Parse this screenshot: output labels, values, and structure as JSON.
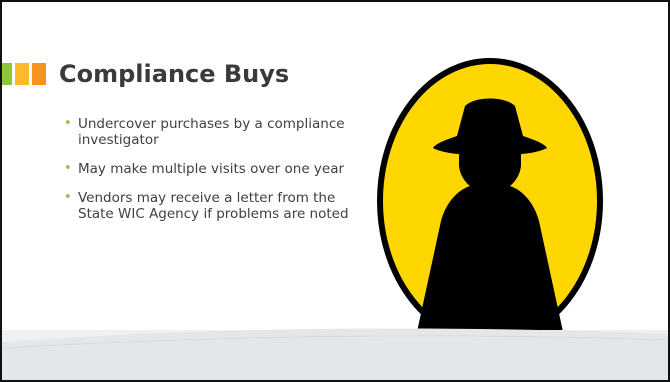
{
  "colors": {
    "accent_green": "#8cc63f",
    "accent_yellow": "#fdb927",
    "accent_orange": "#f7941d",
    "title_text": "#3a3a3a",
    "body_text": "#404040",
    "bullet": "#8cc63f",
    "figure_fill": "#ffd700",
    "figure_outline": "#000000"
  },
  "slide": {
    "title": "Compliance Buys",
    "bullets": [
      {
        "text": "Undercover purchases by a compliance investigator"
      },
      {
        "text": "May make multiple visits over one year"
      },
      {
        "text": "Vendors may receive a letter from the State WIC Agency if problems are noted"
      }
    ]
  },
  "icons": {
    "title_markers": [
      "square-icon",
      "square-icon",
      "square-icon"
    ],
    "bullet": "bullet-dot-icon",
    "figure": "spy-silhouette-icon"
  }
}
